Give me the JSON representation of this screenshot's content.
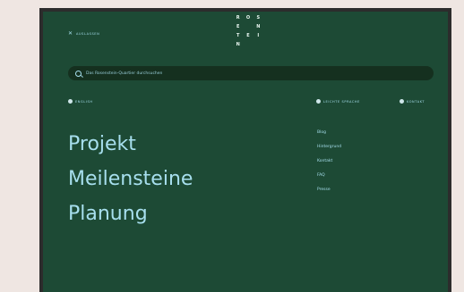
{
  "topbar": {
    "close_label": "AUSLASSEN"
  },
  "logo": {
    "letters": [
      "R",
      "O",
      "S",
      "E",
      "",
      "N",
      "T",
      "E",
      "I",
      "N"
    ]
  },
  "search": {
    "placeholder": "Das Rosenstein-Quartier durchsuchen"
  },
  "language": {
    "english": "ENGLISH",
    "easy": "LEICHTE SPRACHE",
    "contact": "KONTAKT"
  },
  "main_nav": [
    {
      "label": "Projekt"
    },
    {
      "label": "Meilensteine"
    },
    {
      "label": "Planung"
    }
  ],
  "side_nav": [
    {
      "label": "Blog"
    },
    {
      "label": "Hintergrund"
    },
    {
      "label": "Kontakt"
    },
    {
      "label": "FAQ"
    },
    {
      "label": "Presse"
    }
  ],
  "colors": {
    "background": "#1d4a35",
    "accent": "#a7dfee",
    "page": "#efe6e2"
  }
}
